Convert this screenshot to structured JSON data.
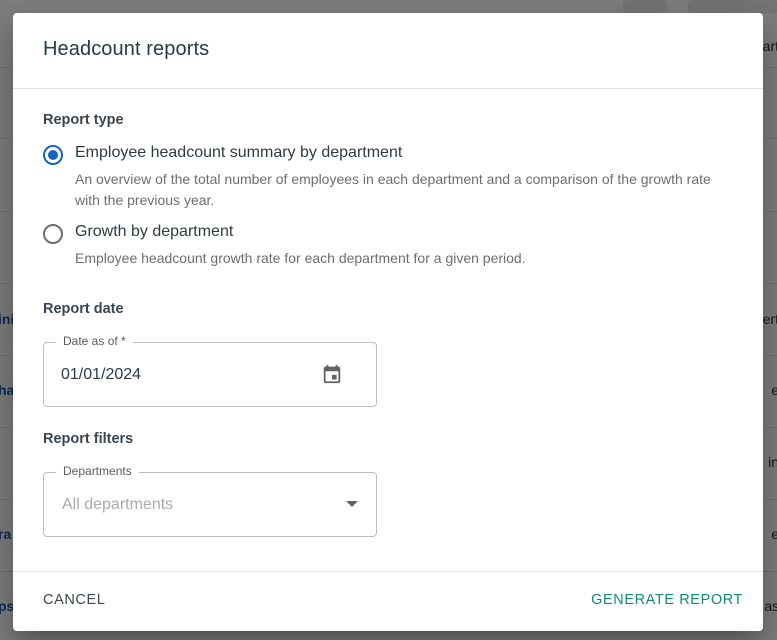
{
  "background": {
    "left_fragments": [
      "ini",
      "ha",
      "ra",
      "ps"
    ],
    "right_fragments": [
      "art",
      "ert",
      "e",
      "in",
      "e",
      "as"
    ]
  },
  "dialog": {
    "title": "Headcount reports",
    "report_type": {
      "label": "Report type",
      "options": [
        {
          "label": "Employee headcount summary by department",
          "description": "An overview of the total number of employees in each department and a comparison of the growth rate with the previous year.",
          "selected": true
        },
        {
          "label": "Growth by department",
          "description": "Employee headcount growth rate for each department for a given period.",
          "selected": false
        }
      ]
    },
    "report_date": {
      "label": "Report date",
      "field_label": "Date as of *",
      "value": "01/01/2024",
      "icon": "calendar-icon"
    },
    "report_filters": {
      "label": "Report filters",
      "field_label": "Departments",
      "placeholder": "All departments",
      "icon": "dropdown-caret-icon"
    },
    "footer": {
      "cancel_label": "CANCEL",
      "generate_label": "GENERATE REPORT"
    }
  },
  "colors": {
    "accent": "#1565c0",
    "primary_action": "#138a74",
    "scrim": "rgba(0,0,0,0.5)"
  }
}
